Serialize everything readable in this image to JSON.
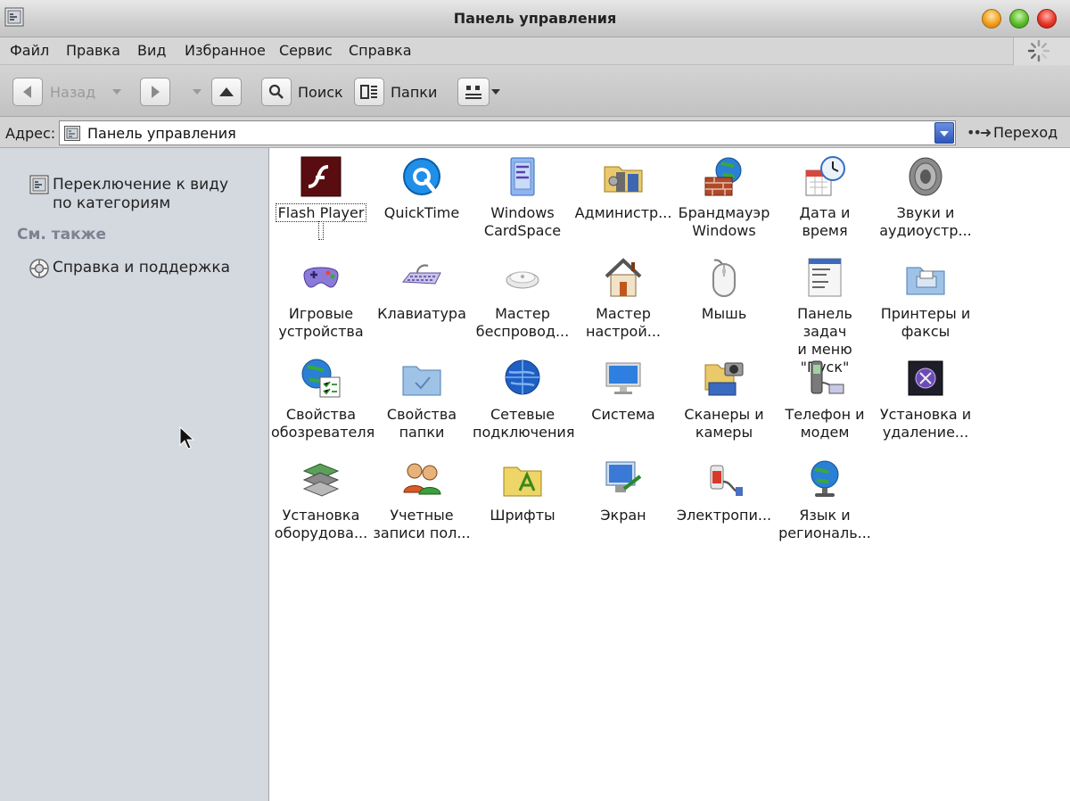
{
  "window": {
    "title": "Панель управления"
  },
  "menu": [
    "Файл",
    "Правка",
    "Вид",
    "Избранное",
    "Сервис",
    "Справка"
  ],
  "toolbar": {
    "back_label": "Назад",
    "search_label": "Поиск",
    "folders_label": "Папки"
  },
  "address": {
    "label": "Адрес:",
    "value": "Панель управления",
    "go_label": "Переход"
  },
  "sidebar": {
    "switch_view_line1": "Переключение к виду",
    "switch_view_line2": "по категориям",
    "see_also_title": "См. также",
    "help_link": "Справка и поддержка"
  },
  "items": [
    {
      "l1": "Flash Player",
      "l2": "",
      "icon": "flash-player-icon"
    },
    {
      "l1": "QuickTime",
      "l2": "",
      "icon": "quicktime-icon"
    },
    {
      "l1": "Windows",
      "l2": "CardSpace",
      "icon": "cardspace-icon"
    },
    {
      "l1": "Администр...",
      "l2": "",
      "icon": "administration-icon"
    },
    {
      "l1": "Брандмауэр",
      "l2": "Windows",
      "icon": "firewall-icon"
    },
    {
      "l1": "Дата и время",
      "l2": "",
      "icon": "date-time-icon"
    },
    {
      "l1": "Звуки и",
      "l2": "аудиоустр...",
      "icon": "sound-icon"
    },
    {
      "l1": "Игровые",
      "l2": "устройства",
      "icon": "game-controller-icon"
    },
    {
      "l1": "Клавиатура",
      "l2": "",
      "icon": "keyboard-icon"
    },
    {
      "l1": "Мастер",
      "l2": "беспровод...",
      "icon": "wireless-wizard-icon"
    },
    {
      "l1": "Мастер",
      "l2": "настрой...",
      "icon": "network-wizard-icon"
    },
    {
      "l1": "Мышь",
      "l2": "",
      "icon": "mouse-icon"
    },
    {
      "l1": "Панель задач",
      "l2": "и меню \"Пуск\"",
      "icon": "taskbar-icon"
    },
    {
      "l1": "Принтеры и",
      "l2": "факсы",
      "icon": "printer-icon"
    },
    {
      "l1": "Свойства",
      "l2": "обозревателя",
      "icon": "internet-options-icon"
    },
    {
      "l1": "Свойства",
      "l2": "папки",
      "icon": "folder-options-icon"
    },
    {
      "l1": "Сетевые",
      "l2": "подключения",
      "icon": "network-icon"
    },
    {
      "l1": "Система",
      "l2": "",
      "icon": "system-icon"
    },
    {
      "l1": "Сканеры и",
      "l2": "камеры",
      "icon": "scanner-camera-icon"
    },
    {
      "l1": "Телефон и",
      "l2": "модем",
      "icon": "phone-modem-icon"
    },
    {
      "l1": "Установка и",
      "l2": "удаление...",
      "icon": "add-remove-icon"
    },
    {
      "l1": "Установка",
      "l2": "оборудова...",
      "icon": "hardware-icon"
    },
    {
      "l1": "Учетные",
      "l2": "записи пол...",
      "icon": "user-accounts-icon"
    },
    {
      "l1": "Шрифты",
      "l2": "",
      "icon": "fonts-icon"
    },
    {
      "l1": "Экран",
      "l2": "",
      "icon": "display-icon"
    },
    {
      "l1": "Электропи...",
      "l2": "",
      "icon": "power-icon"
    },
    {
      "l1": "Язык и",
      "l2": "региональ...",
      "icon": "regional-icon"
    }
  ]
}
